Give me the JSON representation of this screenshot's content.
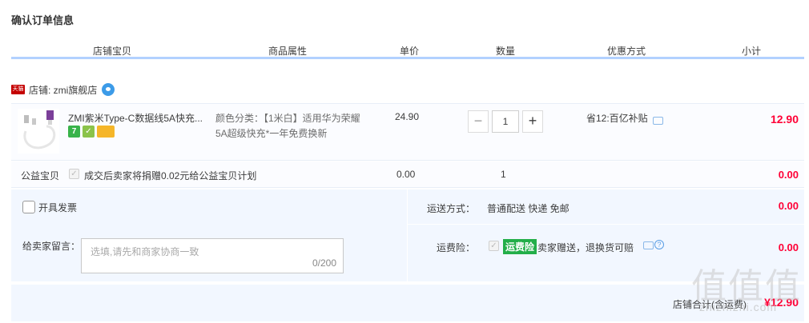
{
  "title": "确认订单信息",
  "header": {
    "shop_item": "店铺宝贝",
    "attributes": "商品属性",
    "unit_price": "单价",
    "quantity": "数量",
    "discount": "优惠方式",
    "subtotal": "小计"
  },
  "shop": {
    "badge": "天猫",
    "name": "店铺: zmi旗舰店"
  },
  "item": {
    "title": "ZMI紫米Type-C数据线5A快充...",
    "badges": [
      "7",
      "✓",
      ""
    ],
    "attributes": "颜色分类：【1米白】适用华为荣耀5A超级快充*一年免费换新",
    "price": "24.90",
    "quantity": "1",
    "promo": "省12:百亿补贴",
    "subtotal": "12.90"
  },
  "charity": {
    "label": "公益宝贝",
    "text": "成交后卖家将捐赠0.02元给公益宝贝计划",
    "price": "0.00",
    "quantity": "1",
    "subtotal": "0.00"
  },
  "invoice": {
    "label": "开具发票"
  },
  "shipping": {
    "label": "运送方式：",
    "value": "普通配送 快递 免邮",
    "cost": "0.00"
  },
  "message": {
    "label": "给卖家留言：",
    "placeholder": "选填,请先和商家协商一致",
    "counter": "0/200"
  },
  "insurance": {
    "label": "运费险：",
    "tag": "运费险",
    "text": "卖家赠送，退换货可赔",
    "cost": "0.00"
  },
  "total": {
    "label": "店铺合计(含运费)",
    "value": "¥12.90"
  },
  "watermark": {
    "big": "值值值",
    "small": "zhizhizhi.com"
  },
  "colors": {
    "price_red": "#ff0036",
    "header_line": "#b2d1ff",
    "panel_bg": "#f2f7ff",
    "insurance_green": "#23ae49",
    "tmall_red": "#c40000"
  }
}
